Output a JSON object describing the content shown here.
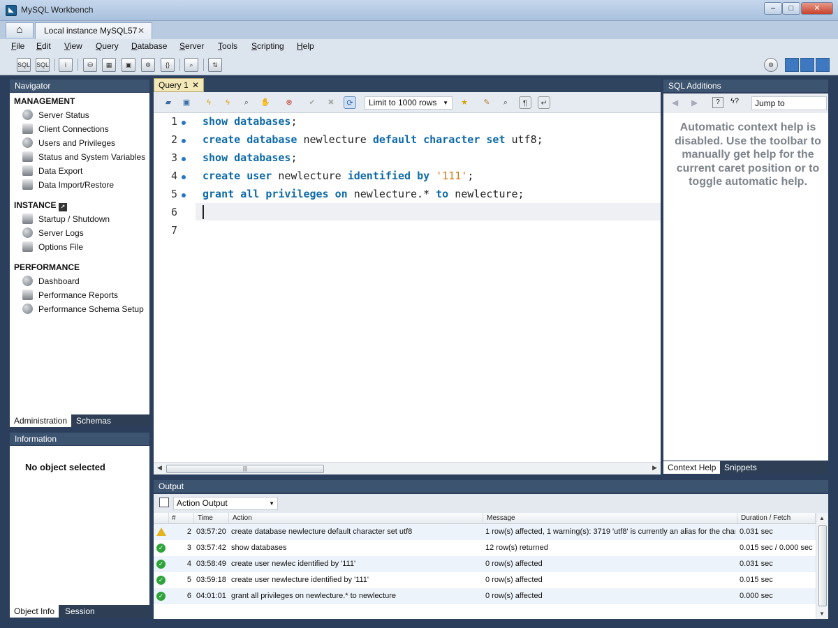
{
  "window": {
    "title": "MySQL Workbench",
    "connection_tab": "Local instance MySQL57"
  },
  "menu": [
    "File",
    "Edit",
    "View",
    "Query",
    "Database",
    "Server",
    "Tools",
    "Scripting",
    "Help"
  ],
  "navigator": {
    "header": "Navigator",
    "management_label": "MANAGEMENT",
    "management": [
      {
        "label": "Server Status",
        "icon": "server-status-icon"
      },
      {
        "label": "Client Connections",
        "icon": "client-connections-icon"
      },
      {
        "label": "Users and Privileges",
        "icon": "users-icon"
      },
      {
        "label": "Status and System Variables",
        "icon": "variables-icon"
      },
      {
        "label": "Data Export",
        "icon": "export-icon"
      },
      {
        "label": "Data Import/Restore",
        "icon": "import-icon"
      }
    ],
    "instance_label": "INSTANCE",
    "instance": [
      {
        "label": "Startup / Shutdown",
        "icon": "power-icon"
      },
      {
        "label": "Server Logs",
        "icon": "warning-icon"
      },
      {
        "label": "Options File",
        "icon": "wrench-icon"
      }
    ],
    "performance_label": "PERFORMANCE",
    "performance": [
      {
        "label": "Dashboard",
        "icon": "dashboard-icon"
      },
      {
        "label": "Performance Reports",
        "icon": "reports-icon"
      },
      {
        "label": "Performance Schema Setup",
        "icon": "schema-setup-icon"
      }
    ],
    "tabs": [
      "Administration",
      "Schemas"
    ]
  },
  "information": {
    "header": "Information",
    "message": "No object selected",
    "tabs": [
      "Object Info",
      "Session"
    ]
  },
  "query": {
    "tab_label": "Query 1",
    "limit_label": "Limit to 1000 rows",
    "lines": [
      {
        "num": "1",
        "tokens": [
          {
            "t": "show",
            "k": "kw"
          },
          {
            "t": " "
          },
          {
            "t": "databases",
            "k": "kw"
          },
          {
            "t": ";"
          }
        ]
      },
      {
        "num": "2",
        "tokens": [
          {
            "t": "create",
            "k": "kw"
          },
          {
            "t": " "
          },
          {
            "t": "database",
            "k": "kw"
          },
          {
            "t": " newlecture "
          },
          {
            "t": "default",
            "k": "kw"
          },
          {
            "t": " "
          },
          {
            "t": "character",
            "k": "kw"
          },
          {
            "t": " "
          },
          {
            "t": "set",
            "k": "kw"
          },
          {
            "t": " utf8;"
          }
        ]
      },
      {
        "num": "3",
        "tokens": [
          {
            "t": "show",
            "k": "kw"
          },
          {
            "t": " "
          },
          {
            "t": "databases",
            "k": "kw"
          },
          {
            "t": ";"
          }
        ]
      },
      {
        "num": "4",
        "tokens": [
          {
            "t": "create",
            "k": "kw"
          },
          {
            "t": " "
          },
          {
            "t": "user",
            "k": "kw"
          },
          {
            "t": " newlecture "
          },
          {
            "t": "identified",
            "k": "kw"
          },
          {
            "t": " "
          },
          {
            "t": "by",
            "k": "kw"
          },
          {
            "t": " "
          },
          {
            "t": "'111'",
            "k": "str"
          },
          {
            "t": ";"
          }
        ]
      },
      {
        "num": "5",
        "tokens": [
          {
            "t": "grant",
            "k": "kw"
          },
          {
            "t": " "
          },
          {
            "t": "all",
            "k": "kw"
          },
          {
            "t": " "
          },
          {
            "t": "privileges",
            "k": "kw"
          },
          {
            "t": " "
          },
          {
            "t": "on",
            "k": "kw"
          },
          {
            "t": " newlecture.* "
          },
          {
            "t": "to",
            "k": "kw"
          },
          {
            "t": " newlecture;"
          }
        ]
      },
      {
        "num": "6",
        "tokens": []
      },
      {
        "num": "7",
        "tokens": []
      }
    ]
  },
  "sql_additions": {
    "header": "SQL Additions",
    "jump_to": "Jump to",
    "help_lines": [
      "Automatic context help is",
      "disabled. Use the toolbar to",
      "manually get help for the",
      "current caret position or to",
      "toggle automatic help."
    ],
    "tabs": [
      "Context Help",
      "Snippets"
    ]
  },
  "output": {
    "header": "Output",
    "selector": "Action Output",
    "columns": [
      "#",
      "Time",
      "Action",
      "Message",
      "Duration / Fetch"
    ],
    "rows": [
      {
        "status": "warning",
        "num": "2",
        "time": "03:57:20",
        "action": "create database newlecture default character set utf8",
        "message": "1 row(s) affected, 1 warning(s): 3719 'utf8' is currently an alias for the char...",
        "duration": "0.031 sec"
      },
      {
        "status": "ok",
        "num": "3",
        "time": "03:57:42",
        "action": "show databases",
        "message": "12 row(s) returned",
        "duration": "0.015 sec / 0.000 sec"
      },
      {
        "status": "ok",
        "num": "4",
        "time": "03:58:49",
        "action": "create user newlec identified by '111'",
        "message": "0 row(s) affected",
        "duration": "0.031 sec"
      },
      {
        "status": "ok",
        "num": "5",
        "time": "03:59:18",
        "action": "create user newlecture identified by '111'",
        "message": "0 row(s) affected",
        "duration": "0.015 sec"
      },
      {
        "status": "ok",
        "num": "6",
        "time": "04:01:01",
        "action": "grant all privileges on newlecture.* to newlecture",
        "message": "0 row(s) affected",
        "duration": "0.000 sec"
      }
    ]
  }
}
